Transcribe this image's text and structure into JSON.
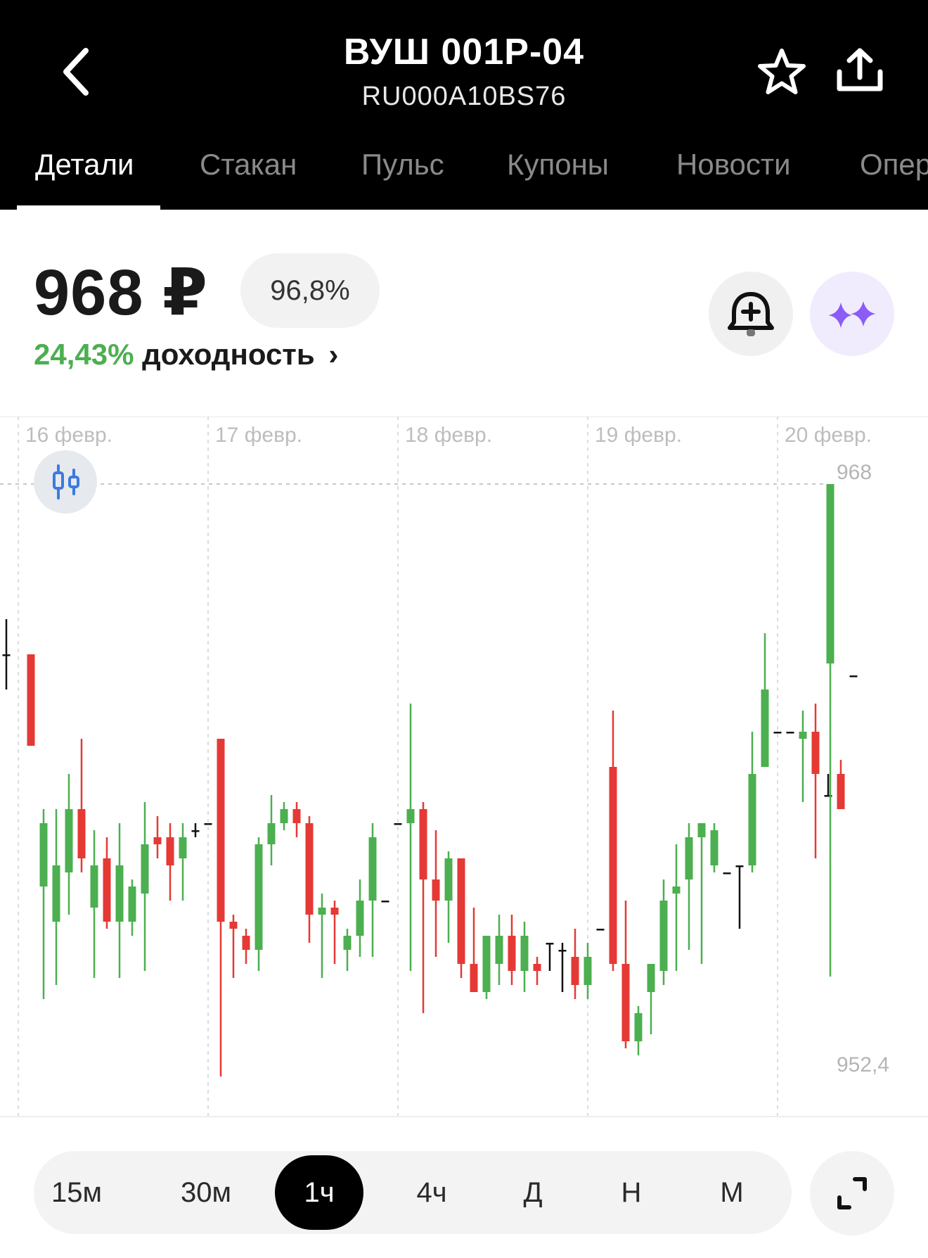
{
  "header": {
    "title": "ВУШ 001P-04",
    "isin": "RU000A10BS76",
    "icons": {
      "back": "chevron-left-icon",
      "favorite": "star-icon",
      "share": "share-icon"
    }
  },
  "tabs": [
    {
      "label": "Детали",
      "active": true
    },
    {
      "label": "Стакан",
      "active": false
    },
    {
      "label": "Пульс",
      "active": false
    },
    {
      "label": "Купоны",
      "active": false
    },
    {
      "label": "Новости",
      "active": false
    },
    {
      "label": "Операции",
      "active": false
    }
  ],
  "quote": {
    "price": "968 ₽",
    "percent_of_nominal": "96,8%",
    "yield_value": "24,43%",
    "yield_label": "доходность",
    "yield_arrow": "›",
    "icons": {
      "alert": "bell-plus-icon",
      "ai": "sparkle-icon"
    }
  },
  "colors": {
    "up": "#4caf50",
    "down": "#e53935",
    "accent_ai": "#8b5cf6",
    "text": "#1a1a1a"
  },
  "chart_data": {
    "type": "candlestick",
    "x_labels": [
      "16 февр.",
      "17 февр.",
      "18 февр.",
      "19 февр.",
      "20 февр."
    ],
    "current_price_label": "968",
    "min_label": "952,4",
    "current_price": 968,
    "ylim": [
      952.4,
      968
    ],
    "interval": "1ч",
    "grid": true
  },
  "timeframes": {
    "items": [
      "15м",
      "30м",
      "1ч",
      "4ч",
      "Д",
      "Н",
      "М"
    ],
    "active": "1ч",
    "expand_icon": "expand-icon"
  }
}
